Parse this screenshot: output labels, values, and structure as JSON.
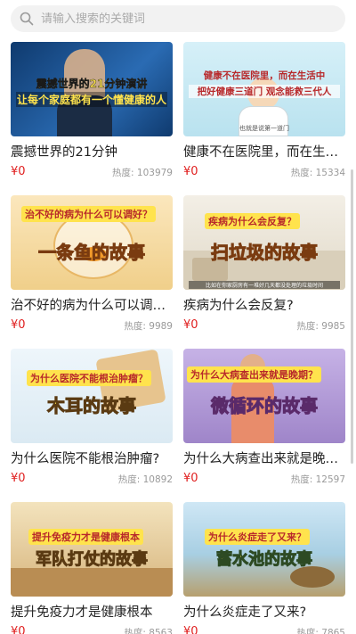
{
  "search": {
    "placeholder": "请输入搜索的关键词"
  },
  "currency": "¥",
  "heat_label": "热度:",
  "items": [
    {
      "title": "震撼世界的21分钟",
      "price": "0",
      "heat": "103979",
      "thumb_line1": "震撼世界的21分钟演讲",
      "thumb_line2": "让每个家庭都有一个懂健康的人",
      "thumb_line3": ""
    },
    {
      "title": "健康不在医院里，而在生…",
      "price": "0",
      "heat": "15334",
      "thumb_line1": "健康不在医院里，而在生活中",
      "thumb_line2": "把好健康三道门 观念能救三代人",
      "thumb_line3": "也就是说第一道门"
    },
    {
      "title": "治不好的病为什么可以调…",
      "price": "0",
      "heat": "9989",
      "thumb_line1": "治不好的病为什么可以调好？",
      "thumb_line2": "一条鱼的故事",
      "thumb_line3": ""
    },
    {
      "title": "疾病为什么会反复?",
      "price": "0",
      "heat": "9985",
      "thumb_line1": "疾病为什么会反复？",
      "thumb_line2": "扫垃圾的故事",
      "thumb_line3": "比如在你家厨房有一堆好几天都没处理的垃圾时间"
    },
    {
      "title": "为什么医院不能根治肿瘤?",
      "price": "0",
      "heat": "10892",
      "thumb_line1": "为什么医院不能根治肿瘤？",
      "thumb_line2": "木耳的故事",
      "thumb_line3": ""
    },
    {
      "title": "为什么大病查出来就是晚…",
      "price": "0",
      "heat": "12597",
      "thumb_line1": "为什么大病查出来就是晚期？",
      "thumb_line2": "微循环的故事",
      "thumb_line3": ""
    },
    {
      "title": "提升免疫力才是健康根本",
      "price": "0",
      "heat": "8563",
      "thumb_line1": "提升免疫力才是健康根本",
      "thumb_line2": "军队打仗的故事",
      "thumb_line3": ""
    },
    {
      "title": "为什么炎症走了又来?",
      "price": "0",
      "heat": "7865",
      "thumb_line1": "为什么炎症走了又来？",
      "thumb_line2": "蓄水池的故事",
      "thumb_line3": ""
    }
  ],
  "colors": {
    "price": "#e02020",
    "search_bg": "#f2f2f2",
    "thumb_bgs": [
      "#1e4f8a",
      "#bfe6f2",
      "#f4dfb0",
      "#ece7dc",
      "#e6f2f8",
      "#b49cd8",
      "#ead6ad",
      "#b8d8ea"
    ],
    "caption_fill": [
      "#ffe34d",
      "#b8292b",
      "#ffe34d",
      "#ffe34d",
      "#ffe34d",
      "#ffe34d",
      "#ffe34d",
      "#ffe34d"
    ]
  }
}
